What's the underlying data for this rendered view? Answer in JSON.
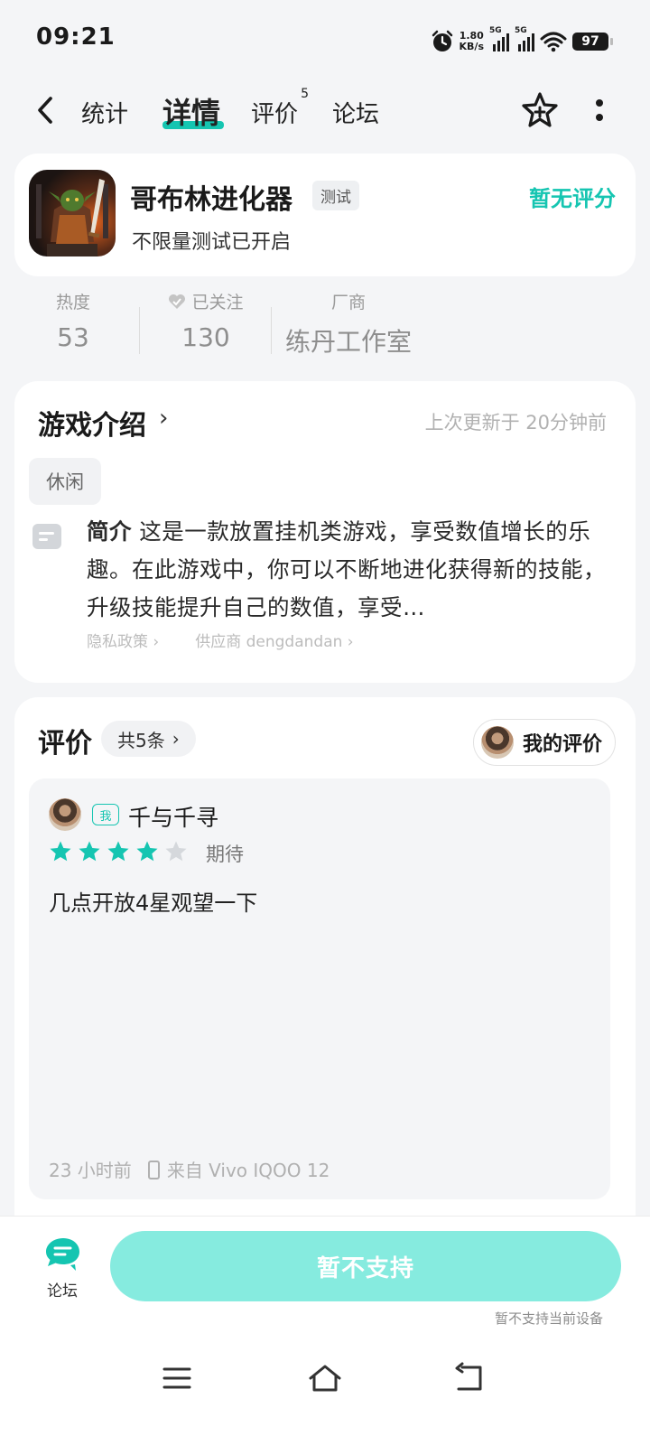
{
  "status_bar": {
    "time": "09:21",
    "net_speed_top": "1.80",
    "net_speed_bottom": "KB/s",
    "sim1": "5G",
    "sim2": "5G",
    "battery": "97",
    "icons": [
      "alarm-icon",
      "signal-icon",
      "signal-icon",
      "wifi-icon",
      "battery-icon"
    ]
  },
  "nav": {
    "tabs": [
      {
        "label": "统计"
      },
      {
        "label": "详情",
        "active": true
      },
      {
        "label": "评价",
        "badge": "5"
      },
      {
        "label": "论坛"
      }
    ],
    "icons": [
      "back-arrow-icon",
      "star-plus-icon",
      "more-icon"
    ]
  },
  "app": {
    "name": "哥布林进化器",
    "tag": "测试",
    "subtitle": "不限量测试已开启",
    "score_text": "暂无评分"
  },
  "stats": [
    {
      "label": "热度",
      "value": "53"
    },
    {
      "label": "已关注",
      "value": "130"
    },
    {
      "label": "厂商",
      "value": "练丹工作室"
    }
  ],
  "intro": {
    "title": "游戏介绍",
    "updated": "上次更新于 20分钟前",
    "genre": "休闲",
    "desc_label": "简介",
    "desc_text": " 这是一款放置挂机类游戏，享受数值增长的乐趣。在此游戏中，你可以不断地进化获得新的技能，升级技能提升自己的数值，享受…",
    "privacy_link": "隐私政策",
    "supplier_link": "供应商 dengdandan"
  },
  "reviews": {
    "title": "评价",
    "count": "共5条",
    "my_review_label": "我的评价",
    "items": [
      {
        "me_badge": "我",
        "user": "千与千寻",
        "rating": 4,
        "max_rating": 5,
        "tag": "期待",
        "text": "几点开放4星观望一下",
        "time": "23 小时前",
        "device": "来自 Vivo IQOO 12"
      }
    ]
  },
  "bottom": {
    "forum_label": "论坛",
    "action_label": "暂不支持",
    "hint": "暂不支持当前设备"
  },
  "colors": {
    "accent": "#15c5b1",
    "button_disabled": "#86ebdf",
    "background": "#f4f5f7"
  }
}
